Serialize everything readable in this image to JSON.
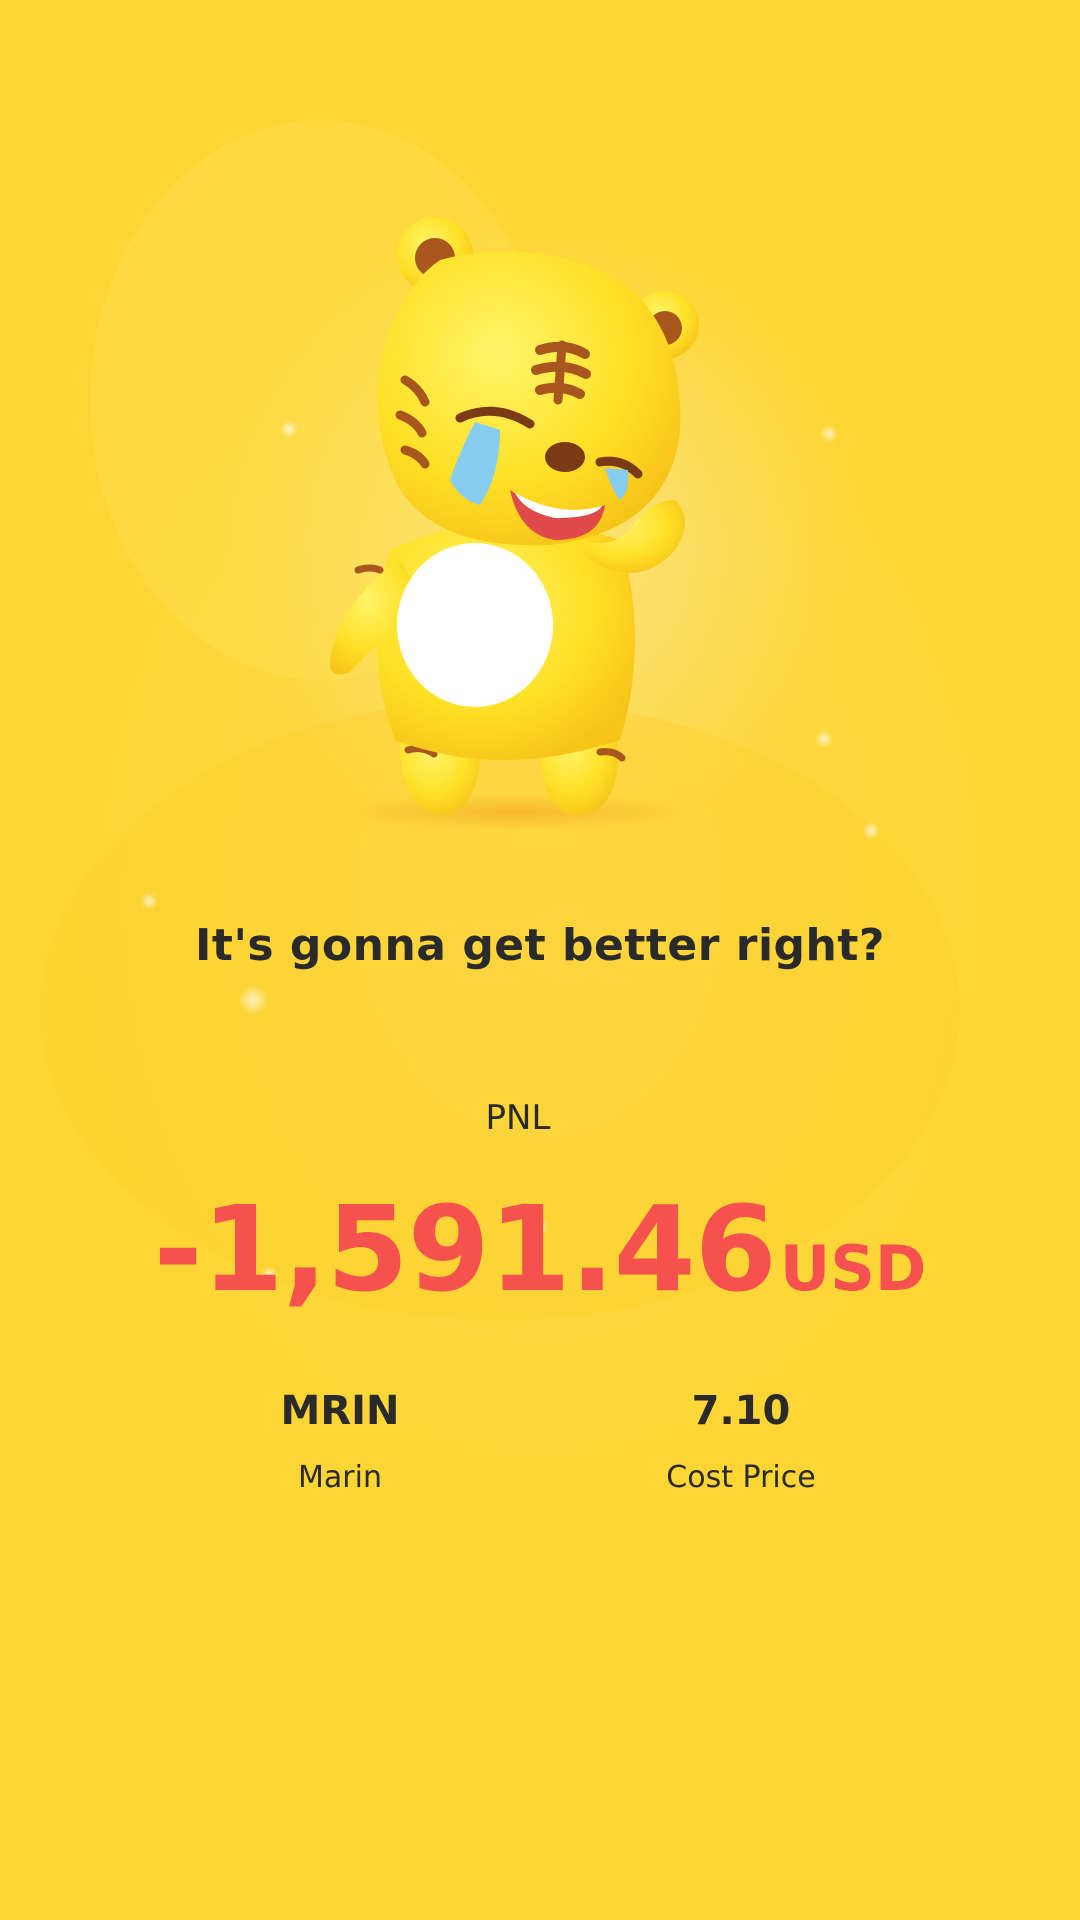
{
  "headline": "It's gonna get better right?",
  "pnl": {
    "label": "PNL",
    "value": "-1,591.46",
    "unit": "USD",
    "color": "#f4514f"
  },
  "stats": [
    {
      "value": "MRIN",
      "label": "Marin"
    },
    {
      "value": "7.10",
      "label": "Cost Price"
    }
  ],
  "mascot": {
    "icon": "crying-tiger-mascot-icon"
  },
  "colors": {
    "background": "#fdd634",
    "text": "#2a2a2a"
  }
}
